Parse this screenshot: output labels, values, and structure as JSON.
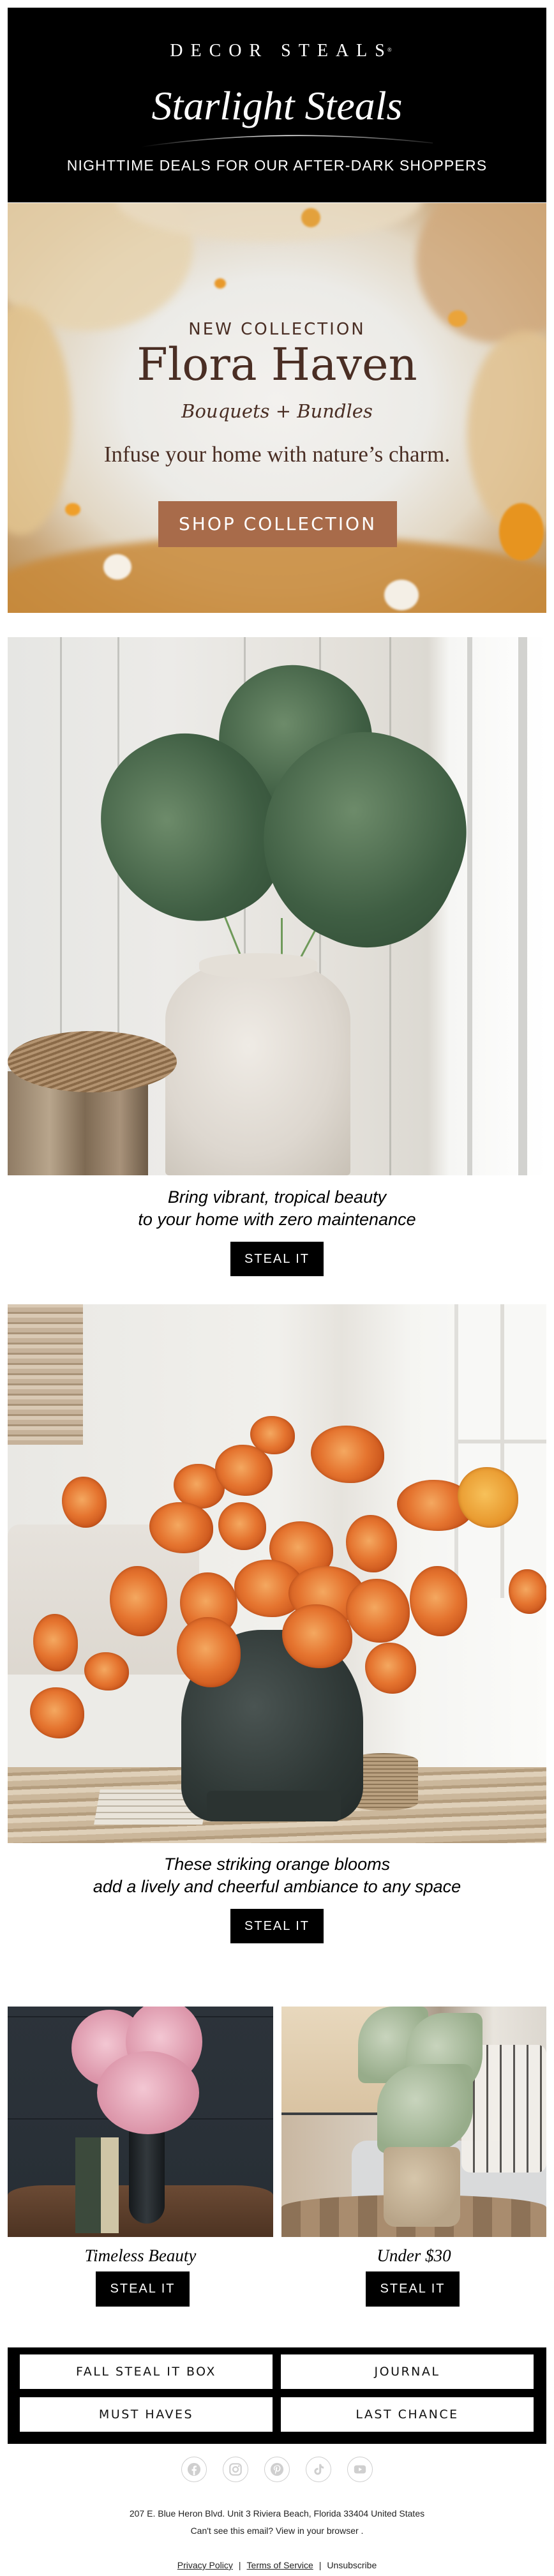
{
  "header": {
    "brand": "DECOR STEALS",
    "brand_mark": "®",
    "event_title": "Starlight Steals",
    "tagline": "NIGHTTIME DEALS FOR OUR AFTER-DARK SHOPPERS"
  },
  "hero": {
    "kicker": "NEW COLLECTION",
    "title": "Flora Haven",
    "subtitle": "Bouquets + Bundles",
    "description": "Infuse your home with nature’s charm.",
    "cta_label": "SHOP COLLECTION",
    "cta_color": "#a86b4a",
    "text_color": "#4a2e24"
  },
  "products": [
    {
      "image_alt": "Monstera leaves in white stoneware vase beside woven stool",
      "caption_line1": "Bring vibrant, tropical beauty",
      "caption_line2": "to your home with zero maintenance",
      "button_label": "STEAL IT"
    },
    {
      "image_alt": "Orange poppy bouquet in dark metal urn on wooden coffee table",
      "caption_line1": "These striking orange blooms",
      "caption_line2": "add a lively and cheerful ambiance to any space",
      "button_label": "STEAL IT"
    }
  ],
  "featured": [
    {
      "image_alt": "Pink hydrangeas in tall black vase with vintage books",
      "caption": "Timeless Beauty",
      "button_label": "STEAL IT"
    },
    {
      "image_alt": "Lamb's ear greenery in stone pot on wooden side table",
      "caption": "Under $30",
      "button_label": "STEAL IT"
    }
  ],
  "nav": {
    "items": [
      {
        "label": "FALL STEAL IT BOX"
      },
      {
        "label": "JOURNAL"
      },
      {
        "label": "MUST HAVES"
      },
      {
        "label": "LAST CHANCE"
      }
    ]
  },
  "social": [
    {
      "icon": "facebook-icon",
      "label": "Facebook"
    },
    {
      "icon": "instagram-icon",
      "label": "Instagram"
    },
    {
      "icon": "pinterest-icon",
      "label": "Pinterest"
    },
    {
      "icon": "tiktok-icon",
      "label": "TikTok"
    },
    {
      "icon": "youtube-icon",
      "label": "YouTube"
    }
  ],
  "footer": {
    "address": "207 E. Blue Heron Blvd. Unit 3 Riviera Beach, Florida 33404 United States",
    "view_in_browser": "Can't see this email? View in your browser .",
    "links": {
      "privacy": "Privacy Policy",
      "terms": "Terms of Service",
      "unsubscribe": "Unsubscribe",
      "separator": "|"
    }
  }
}
